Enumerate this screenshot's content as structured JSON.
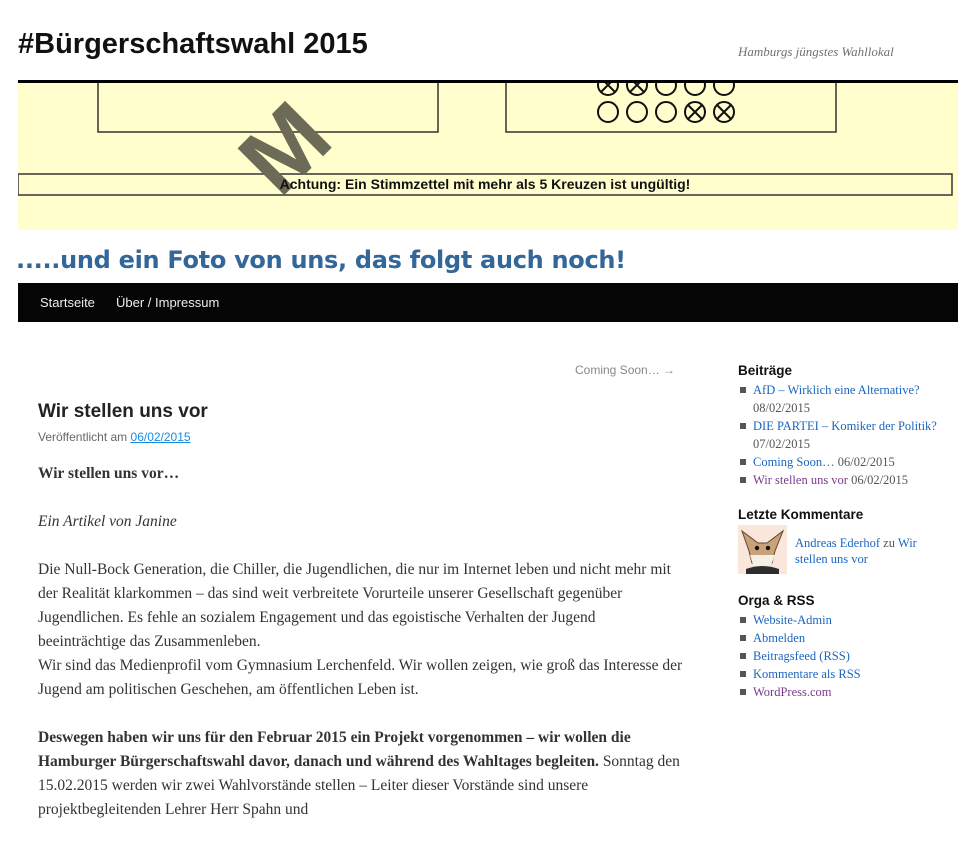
{
  "site": {
    "title": "#Bürgerschaftswahl 2015",
    "description": "Hamburgs jüngstes Wahllokal"
  },
  "banner": {
    "ballot_watermark": "M",
    "warning_text": "Achtung: Ein Stimmzettel mit mehr als 5 Kreuzen ist ungültig!",
    "footer_text": ".....und ein Foto von uns, das folgt auch noch!",
    "colors": {
      "background": "#fffecc",
      "footer_text": "#336699"
    }
  },
  "nav": {
    "items": [
      {
        "label": "Startseite"
      },
      {
        "label": "Über / Impressum"
      }
    ]
  },
  "post_nav": {
    "next": "Coming Soon… →"
  },
  "post": {
    "title": "Wir stellen uns vor",
    "meta_prefix": "Veröffentlicht am",
    "date": "06/02/2015",
    "intro_heading": "Wir stellen uns vor…",
    "byline": "Ein Artikel von Janine",
    "para1": "Die Null-Bock Generation, die Chiller, die Jugendlichen, die nur im Internet leben und nicht mehr mit der Realität klarkommen – das sind weit verbreitete Vorurteile unserer Gesellschaft gegenüber Jugendlichen. Es fehle an sozialem Engagement und das egoistische Verhalten der Jugend beeinträchtige das Zusammenleben.",
    "para1b": "Wir sind das Medienprofil vom Gymnasium Lerchenfeld. Wir wollen zeigen, wie groß das Interesse der Jugend am politischen Geschehen, am öffentlichen Leben ist.",
    "para2_bold": "Deswegen haben wir uns für den Februar 2015 ein Projekt vorgenommen – wir wollen die Hamburger Bürgerschaftswahl davor, danach und während des Wahltages begleiten.",
    "para2_rest": " Sonntag den 15.02.2015 werden wir zwei Wahlvorstände stellen – Leiter dieser Vorstände sind unsere projektbegleitenden Lehrer Herr Spahn und"
  },
  "sidebar": {
    "posts_title": "Beiträge",
    "posts": [
      {
        "label": "AfD – Wirklich eine Alternative?",
        "date": "08/02/2015"
      },
      {
        "label": "DIE PARTEI – Komiker der Politik?",
        "date": "07/02/2015"
      },
      {
        "label": "Coming Soon…",
        "date": "06/02/2015"
      },
      {
        "label": "Wir stellen uns vor",
        "date": "06/02/2015"
      }
    ],
    "comments_title": "Letzte Kommentare",
    "comment": {
      "author": "Andreas Ederhof",
      "connector": "zu",
      "post": "Wir stellen uns vor"
    },
    "meta_title": "Orga & RSS",
    "meta_links": [
      {
        "label": "Website-Admin"
      },
      {
        "label": "Abmelden"
      },
      {
        "label": "Beitragsfeed (RSS)"
      },
      {
        "label": "Kommentare als RSS"
      },
      {
        "label": "WordPress.com"
      }
    ]
  }
}
